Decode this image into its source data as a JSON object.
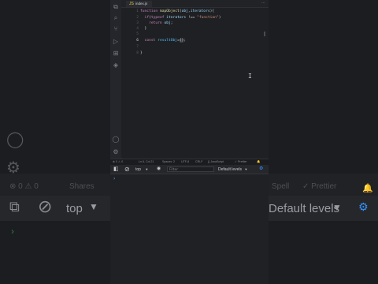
{
  "editor": {
    "tab_label": "index.js",
    "lines": [
      {
        "n": "1",
        "text": "function mapObject(obj,iterators){"
      },
      {
        "n": "2",
        "text": "  if(typeof iterators !== \"function\")"
      },
      {
        "n": "3",
        "text": "    return obj;"
      },
      {
        "n": "4",
        "text": "  }"
      },
      {
        "n": "5",
        "text": ""
      },
      {
        "n": "6",
        "text": "  const resultObj={};"
      },
      {
        "n": "7",
        "text": ""
      },
      {
        "n": "8",
        "text": "}"
      }
    ]
  },
  "statusbar": {
    "left": "⊗ 0 ⚠ 0",
    "position": "Ln 6, Col 21",
    "spaces": "Spaces: 2",
    "encoding": "UTF-8",
    "eol": "CRLF",
    "language": "{} JavaScript",
    "prettier": "✓ Prettier"
  },
  "console": {
    "context": "top",
    "filter_placeholder": "Filter",
    "levels": "Default levels",
    "prompt": "›"
  },
  "background": {
    "issues": "⊗ 0  ⚠ 0",
    "shares": "Shares",
    "spell": "Spell",
    "prettier": "✓ Prettier",
    "context": "top",
    "levels": "Default levels"
  },
  "icons": [
    "explorer-icon",
    "search-icon",
    "source-control-icon",
    "run-debug-icon",
    "extensions-icon",
    "account-icon",
    "settings-icon",
    "sidebar-toggle-icon",
    "clear-console-icon",
    "eye-icon",
    "gear-icon"
  ],
  "colors": {
    "keyword": "#c586c0",
    "function": "#dcdcaa",
    "param": "#9cdcfe",
    "string": "#ce9178",
    "accent": "#3794ff"
  }
}
